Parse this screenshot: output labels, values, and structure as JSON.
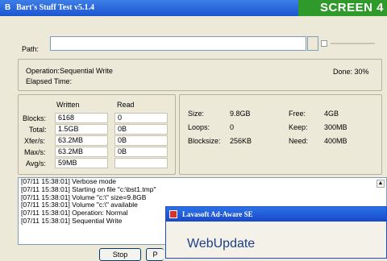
{
  "window": {
    "title": "Bart's Stuff Test v5.1.4",
    "title_icon": "B"
  },
  "badge": "SCREEN 4",
  "path": {
    "label": "Path:",
    "value": ""
  },
  "operation": {
    "text": "Operation:Sequential Write",
    "elapsed": "Elapsed Time:",
    "done": "Done: 30%"
  },
  "stats": {
    "col_written": "Written",
    "col_read": "Read",
    "rows": [
      {
        "label": "Blocks:",
        "written": "6168",
        "read": "0"
      },
      {
        "label": "Total:",
        "written": "1.5GB",
        "read": "0B"
      },
      {
        "label": "Xfer/s:",
        "written": "63.2MB",
        "read": "0B"
      },
      {
        "label": "Max/s:",
        "written": "63.2MB",
        "read": "0B"
      },
      {
        "label": "Avg/s:",
        "written": "59MB",
        "read": ""
      }
    ]
  },
  "disk": {
    "size_label": "Size:",
    "size": "9.8GB",
    "loops_label": "Loops:",
    "loops": "0",
    "blocksize_label": "Blocksize:",
    "blocksize": "256KB",
    "free_label": "Free:",
    "free": "4GB",
    "keep_label": "Keep:",
    "keep": "300MB",
    "need_label": "Need:",
    "need": "400MB"
  },
  "log": [
    "[07/11 15:38:01] Verbose mode",
    "[07/11 15:38:01] Starting on file \"c:\\bst1.tmp\"",
    "[07/11 15:38:01] Volume \"c:\\\" size=9.8GB",
    "[07/11 15:38:01] Volume \"c:\\\" available",
    "[07/11 15:38:01] Operation: Normal",
    "[07/11 15:38:01] Sequential Write"
  ],
  "buttons": {
    "stop": "Stop",
    "partial": "P"
  },
  "popup": {
    "title": "Lavasoft Ad-Aware SE",
    "heading": "WebUpdate"
  }
}
